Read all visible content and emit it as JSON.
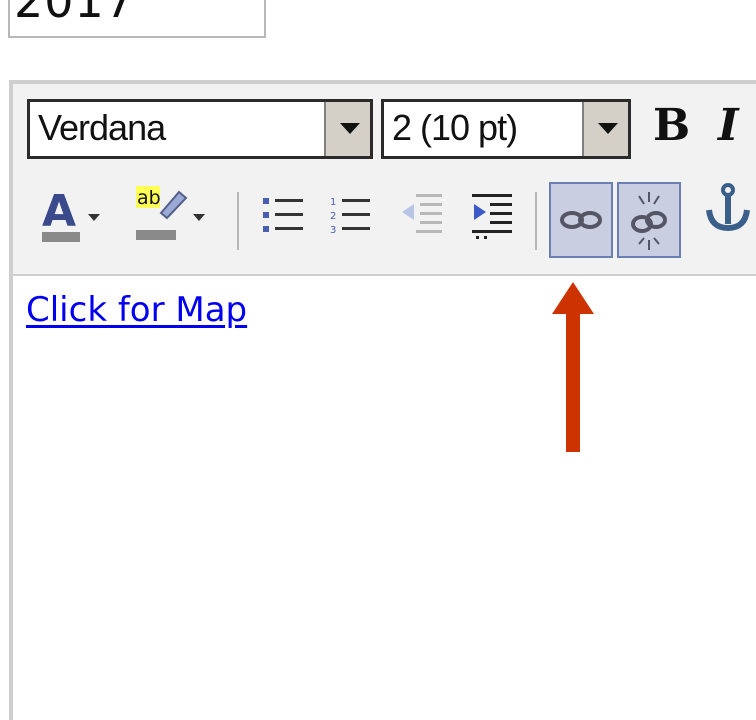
{
  "year_field": {
    "value": "2017"
  },
  "toolbar": {
    "font_name": "Verdana",
    "font_size": "2 (10 pt)",
    "bold_label": "B",
    "italic_label": "I",
    "highlight_label": "ab",
    "icons": [
      "font-color-icon",
      "highlight-color-icon",
      "bullet-list-icon",
      "numbered-list-icon",
      "outdent-icon",
      "indent-icon",
      "insert-link-icon",
      "unlink-icon",
      "anchor-icon"
    ]
  },
  "content": {
    "link_text": "Click for Map"
  },
  "colors": {
    "arrow": "#cc3300",
    "link": "#0000ee",
    "pressed_bg": "#c9cfe0",
    "pressed_border": "#6b7fb3"
  }
}
